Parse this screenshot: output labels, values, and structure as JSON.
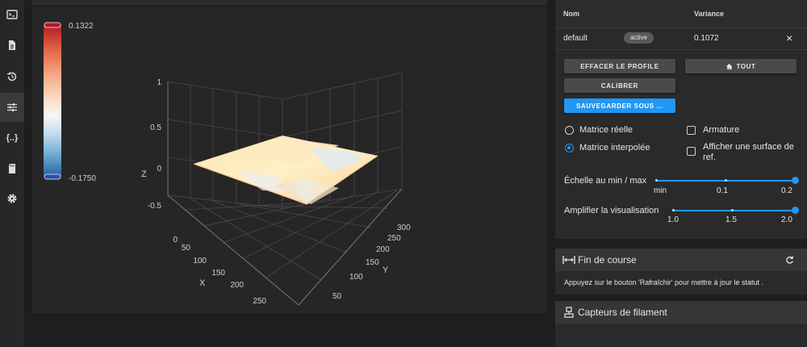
{
  "sidebar": {
    "items": [
      {
        "icon": "terminal-icon"
      },
      {
        "icon": "file-icon"
      },
      {
        "icon": "history-icon"
      },
      {
        "icon": "tune-icon",
        "active": true
      },
      {
        "icon": "code-braces-icon"
      },
      {
        "icon": "sd-card-icon"
      },
      {
        "icon": "gear-icon"
      }
    ]
  },
  "plot": {
    "colorbar": {
      "max": "0.1322",
      "min": "-0.1750",
      "colors": [
        "#b2182b",
        "#ef8a62",
        "#fddbc7",
        "#f7f7f7",
        "#d1e5f0",
        "#67a9cf",
        "#2166ac"
      ]
    },
    "z_ticks": [
      "1",
      "0.5",
      "0",
      "-0.5"
    ],
    "z_label": "Z",
    "x_ticks": [
      "0",
      "50",
      "100",
      "150",
      "200",
      "250"
    ],
    "x_label": "X",
    "y_ticks": [
      "50",
      "100",
      "150",
      "200",
      "250",
      "300"
    ],
    "y_label": "Y"
  },
  "profiles": {
    "headers": {
      "name": "Nom",
      "variance": "Variance"
    },
    "rows": [
      {
        "name": "default",
        "badge": "active",
        "variance": "0.1072"
      }
    ],
    "close_glyph": "×"
  },
  "actions": {
    "clear": "EFFACER LE PROFILE",
    "home": "TOUT",
    "calibrate": "CALIBRER",
    "save_as": "SAUVEGARDER SOUS ..."
  },
  "options": {
    "matrix_real": "Matrice réelle",
    "matrix_interp": "Matrice interpolée",
    "wireframe": "Armature",
    "ref_surface": "Afficher une surface de ref."
  },
  "scale_slider": {
    "label": "Échelle au min / max",
    "ticks": [
      "min",
      "0.1",
      "0.2"
    ],
    "value": 0.2
  },
  "amplify_slider": {
    "label": "Amplifier la visualisation",
    "ticks": [
      "1.0",
      "1.5",
      "2.0"
    ],
    "value": 2.0
  },
  "endstops": {
    "title": "Fin de course",
    "message": "Appuyez sur le bouton 'Rafraîchir' pour mettre à jour le statut ."
  },
  "filament": {
    "title": "Capteurs de filament"
  }
}
